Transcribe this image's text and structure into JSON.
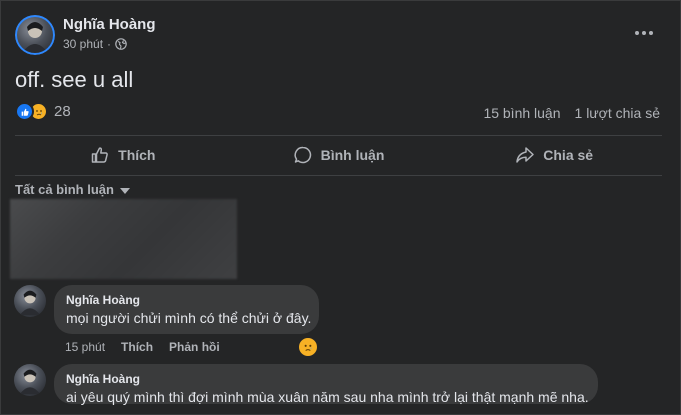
{
  "post": {
    "author": "Nghĩa Hoàng",
    "time": "30 phút",
    "separator": "·",
    "privacy_icon": "globe-icon",
    "text": "off. see u all",
    "reaction_icons": [
      "like-icon",
      "sad-icon"
    ],
    "reaction_count": "28",
    "comments_count": "15 bình luận",
    "shares_count": "1 lượt chia sẻ"
  },
  "actions": {
    "like": "Thích",
    "comment": "Bình luận",
    "share": "Chia sẻ"
  },
  "comments_filter": "Tất cả bình luận",
  "comments": [
    {
      "author": "Nghĩa Hoàng",
      "text": "mọi người chửi mình có thể chửi ở đây.",
      "time": "15 phút",
      "like": "Thích",
      "reply": "Phản hồi",
      "reaction_icon": "sad-icon"
    },
    {
      "author": "Nghĩa Hoàng",
      "text": "ai yêu quý mình thì đợi mình mùa xuân năm sau nha mình trở lại thật mạnh mẽ nha."
    }
  ],
  "colors": {
    "background": "#242526",
    "bubble": "#3a3b3c",
    "accent": "#1877f2",
    "sad": "#f7b125",
    "muted_text": "#b0b3b8"
  }
}
